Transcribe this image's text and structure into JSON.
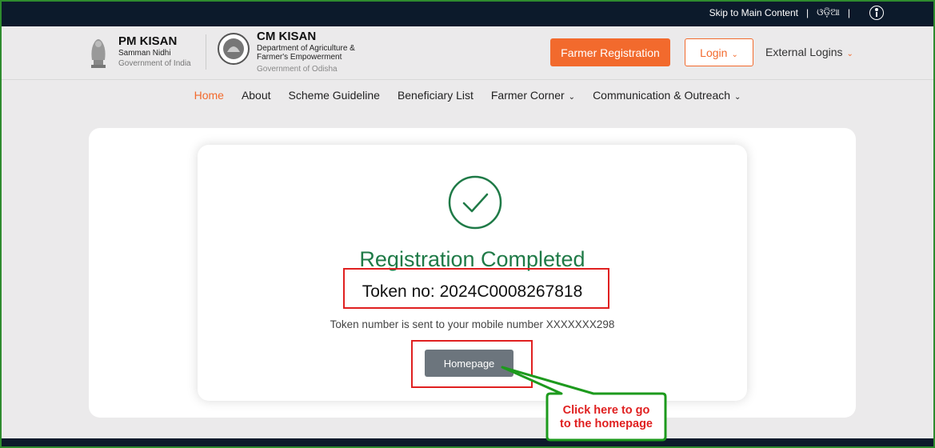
{
  "topbar": {
    "skip_label": "Skip to Main Content",
    "odia_label": "ଓଡ଼ିଆ"
  },
  "header": {
    "pm_title": "PM KISAN",
    "pm_sub": "Samman Nidhi",
    "pm_gov": "Government of India",
    "cm_title": "CM KISAN",
    "cm_sub_line1": "Department of Agriculture &",
    "cm_sub_line2": "Farmer's Empowerment",
    "cm_gov": "Government of Odisha",
    "register_label": "Farmer Registration",
    "login_label": "Login",
    "external_label": "External Logins"
  },
  "nav": [
    {
      "label": "Home"
    },
    {
      "label": "About"
    },
    {
      "label": "Scheme Guideline"
    },
    {
      "label": "Beneficiary List"
    },
    {
      "label": "Farmer Corner"
    },
    {
      "label": "Communication & Outreach"
    }
  ],
  "main": {
    "title": "Registration Completed",
    "token_text": "Token no: 2024C0008267818",
    "note": "Token number is sent to your mobile number XXXXXXX298",
    "homepage_label": "Homepage"
  },
  "annotation": {
    "line1": "Click here to go",
    "line2": "to the homepage"
  },
  "colors": {
    "accent": "#f26a2d",
    "success": "#1f7a47",
    "dark": "#0c1a2b",
    "highlight": "#e02020",
    "callout_border": "#1d9a1d"
  }
}
